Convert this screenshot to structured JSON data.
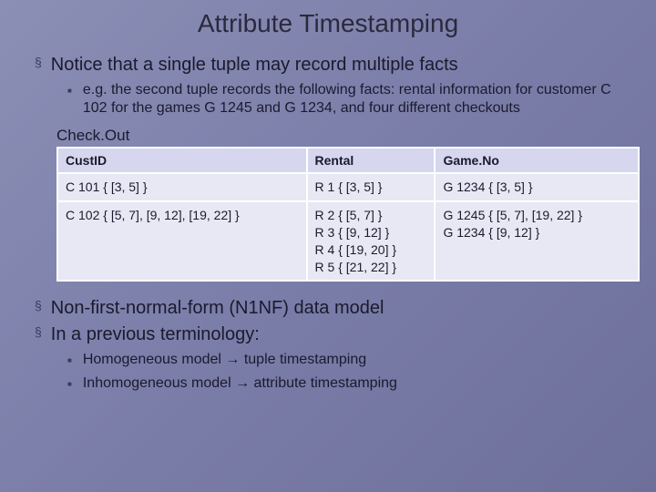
{
  "title": "Attribute Timestamping",
  "bullets": {
    "b1": "Notice that a single tuple may record multiple facts",
    "b1_1": "e.g. the second tuple records the following facts: rental information for customer C 102 for the games G 1245 and G 1234, and four different checkouts",
    "b2": "Non-first-normal-form (N1NF) data model",
    "b3": "In a previous terminology:",
    "b3_1": "Homogeneous model → tuple timestamping",
    "b3_2": "Inhomogeneous model → attribute timestamping"
  },
  "table": {
    "label": "Check.Out",
    "headers": {
      "h1": "CustID",
      "h2": "Rental",
      "h3": "Game.No"
    },
    "rows": {
      "r1c1": "C 101   { [3, 5] }",
      "r1c2": "R 1   { [3, 5] }",
      "r1c3": "G 1234   { [3, 5] }",
      "r2c1": "C 102   { [5, 7], [9, 12], [19, 22] }",
      "r2c2": "R 2   { [5, 7] }\nR 3   { [9, 12] }\nR 4   { [19, 20] }\nR 5   { [21, 22] }",
      "r2c3": "G 1245   { [5, 7], [19, 22] }\nG 1234   { [9, 12] }"
    }
  }
}
